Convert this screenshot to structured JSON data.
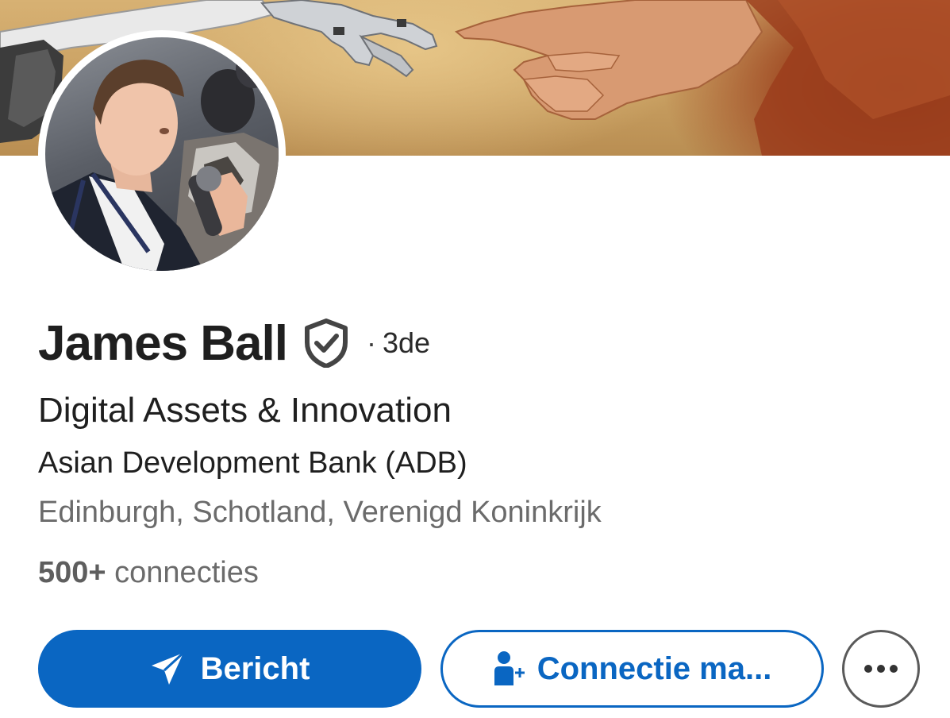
{
  "profile": {
    "name": "James Ball",
    "degree_separator": "·",
    "degree": "3de",
    "headline": "Digital Assets & Innovation",
    "company": "Asian Development Bank (ADB)",
    "location": "Edinburgh, Schotland, Verenigd Koninkrijk",
    "connections_count": "500+",
    "connections_label": "connecties"
  },
  "actions": {
    "message_label": "Bericht",
    "connect_label": "Connectie ma..."
  },
  "icons": {
    "verified": "verified-shield-icon",
    "message": "paper-plane-icon",
    "connect": "add-person-icon",
    "more": "more-dots-icon"
  },
  "colors": {
    "accent": "#0a66c2",
    "text_primary": "#1f1f1f",
    "text_secondary": "#6b6b6b"
  }
}
